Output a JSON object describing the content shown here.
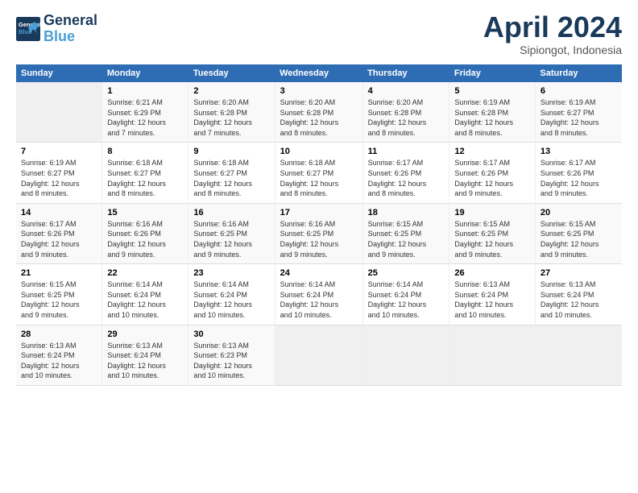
{
  "header": {
    "logo_line1": "General",
    "logo_line2": "Blue",
    "month": "April 2024",
    "location": "Sipiongot, Indonesia"
  },
  "days_of_week": [
    "Sunday",
    "Monday",
    "Tuesday",
    "Wednesday",
    "Thursday",
    "Friday",
    "Saturday"
  ],
  "weeks": [
    [
      {
        "num": "",
        "info": ""
      },
      {
        "num": "1",
        "info": "Sunrise: 6:21 AM\nSunset: 6:29 PM\nDaylight: 12 hours\nand 7 minutes."
      },
      {
        "num": "2",
        "info": "Sunrise: 6:20 AM\nSunset: 6:28 PM\nDaylight: 12 hours\nand 7 minutes."
      },
      {
        "num": "3",
        "info": "Sunrise: 6:20 AM\nSunset: 6:28 PM\nDaylight: 12 hours\nand 8 minutes."
      },
      {
        "num": "4",
        "info": "Sunrise: 6:20 AM\nSunset: 6:28 PM\nDaylight: 12 hours\nand 8 minutes."
      },
      {
        "num": "5",
        "info": "Sunrise: 6:19 AM\nSunset: 6:28 PM\nDaylight: 12 hours\nand 8 minutes."
      },
      {
        "num": "6",
        "info": "Sunrise: 6:19 AM\nSunset: 6:27 PM\nDaylight: 12 hours\nand 8 minutes."
      }
    ],
    [
      {
        "num": "7",
        "info": "Sunrise: 6:19 AM\nSunset: 6:27 PM\nDaylight: 12 hours\nand 8 minutes."
      },
      {
        "num": "8",
        "info": "Sunrise: 6:18 AM\nSunset: 6:27 PM\nDaylight: 12 hours\nand 8 minutes."
      },
      {
        "num": "9",
        "info": "Sunrise: 6:18 AM\nSunset: 6:27 PM\nDaylight: 12 hours\nand 8 minutes."
      },
      {
        "num": "10",
        "info": "Sunrise: 6:18 AM\nSunset: 6:27 PM\nDaylight: 12 hours\nand 8 minutes."
      },
      {
        "num": "11",
        "info": "Sunrise: 6:17 AM\nSunset: 6:26 PM\nDaylight: 12 hours\nand 8 minutes."
      },
      {
        "num": "12",
        "info": "Sunrise: 6:17 AM\nSunset: 6:26 PM\nDaylight: 12 hours\nand 9 minutes."
      },
      {
        "num": "13",
        "info": "Sunrise: 6:17 AM\nSunset: 6:26 PM\nDaylight: 12 hours\nand 9 minutes."
      }
    ],
    [
      {
        "num": "14",
        "info": "Sunrise: 6:17 AM\nSunset: 6:26 PM\nDaylight: 12 hours\nand 9 minutes."
      },
      {
        "num": "15",
        "info": "Sunrise: 6:16 AM\nSunset: 6:26 PM\nDaylight: 12 hours\nand 9 minutes."
      },
      {
        "num": "16",
        "info": "Sunrise: 6:16 AM\nSunset: 6:25 PM\nDaylight: 12 hours\nand 9 minutes."
      },
      {
        "num": "17",
        "info": "Sunrise: 6:16 AM\nSunset: 6:25 PM\nDaylight: 12 hours\nand 9 minutes."
      },
      {
        "num": "18",
        "info": "Sunrise: 6:15 AM\nSunset: 6:25 PM\nDaylight: 12 hours\nand 9 minutes."
      },
      {
        "num": "19",
        "info": "Sunrise: 6:15 AM\nSunset: 6:25 PM\nDaylight: 12 hours\nand 9 minutes."
      },
      {
        "num": "20",
        "info": "Sunrise: 6:15 AM\nSunset: 6:25 PM\nDaylight: 12 hours\nand 9 minutes."
      }
    ],
    [
      {
        "num": "21",
        "info": "Sunrise: 6:15 AM\nSunset: 6:25 PM\nDaylight: 12 hours\nand 9 minutes."
      },
      {
        "num": "22",
        "info": "Sunrise: 6:14 AM\nSunset: 6:24 PM\nDaylight: 12 hours\nand 10 minutes."
      },
      {
        "num": "23",
        "info": "Sunrise: 6:14 AM\nSunset: 6:24 PM\nDaylight: 12 hours\nand 10 minutes."
      },
      {
        "num": "24",
        "info": "Sunrise: 6:14 AM\nSunset: 6:24 PM\nDaylight: 12 hours\nand 10 minutes."
      },
      {
        "num": "25",
        "info": "Sunrise: 6:14 AM\nSunset: 6:24 PM\nDaylight: 12 hours\nand 10 minutes."
      },
      {
        "num": "26",
        "info": "Sunrise: 6:13 AM\nSunset: 6:24 PM\nDaylight: 12 hours\nand 10 minutes."
      },
      {
        "num": "27",
        "info": "Sunrise: 6:13 AM\nSunset: 6:24 PM\nDaylight: 12 hours\nand 10 minutes."
      }
    ],
    [
      {
        "num": "28",
        "info": "Sunrise: 6:13 AM\nSunset: 6:24 PM\nDaylight: 12 hours\nand 10 minutes."
      },
      {
        "num": "29",
        "info": "Sunrise: 6:13 AM\nSunset: 6:24 PM\nDaylight: 12 hours\nand 10 minutes."
      },
      {
        "num": "30",
        "info": "Sunrise: 6:13 AM\nSunset: 6:23 PM\nDaylight: 12 hours\nand 10 minutes."
      },
      {
        "num": "",
        "info": ""
      },
      {
        "num": "",
        "info": ""
      },
      {
        "num": "",
        "info": ""
      },
      {
        "num": "",
        "info": ""
      }
    ]
  ]
}
